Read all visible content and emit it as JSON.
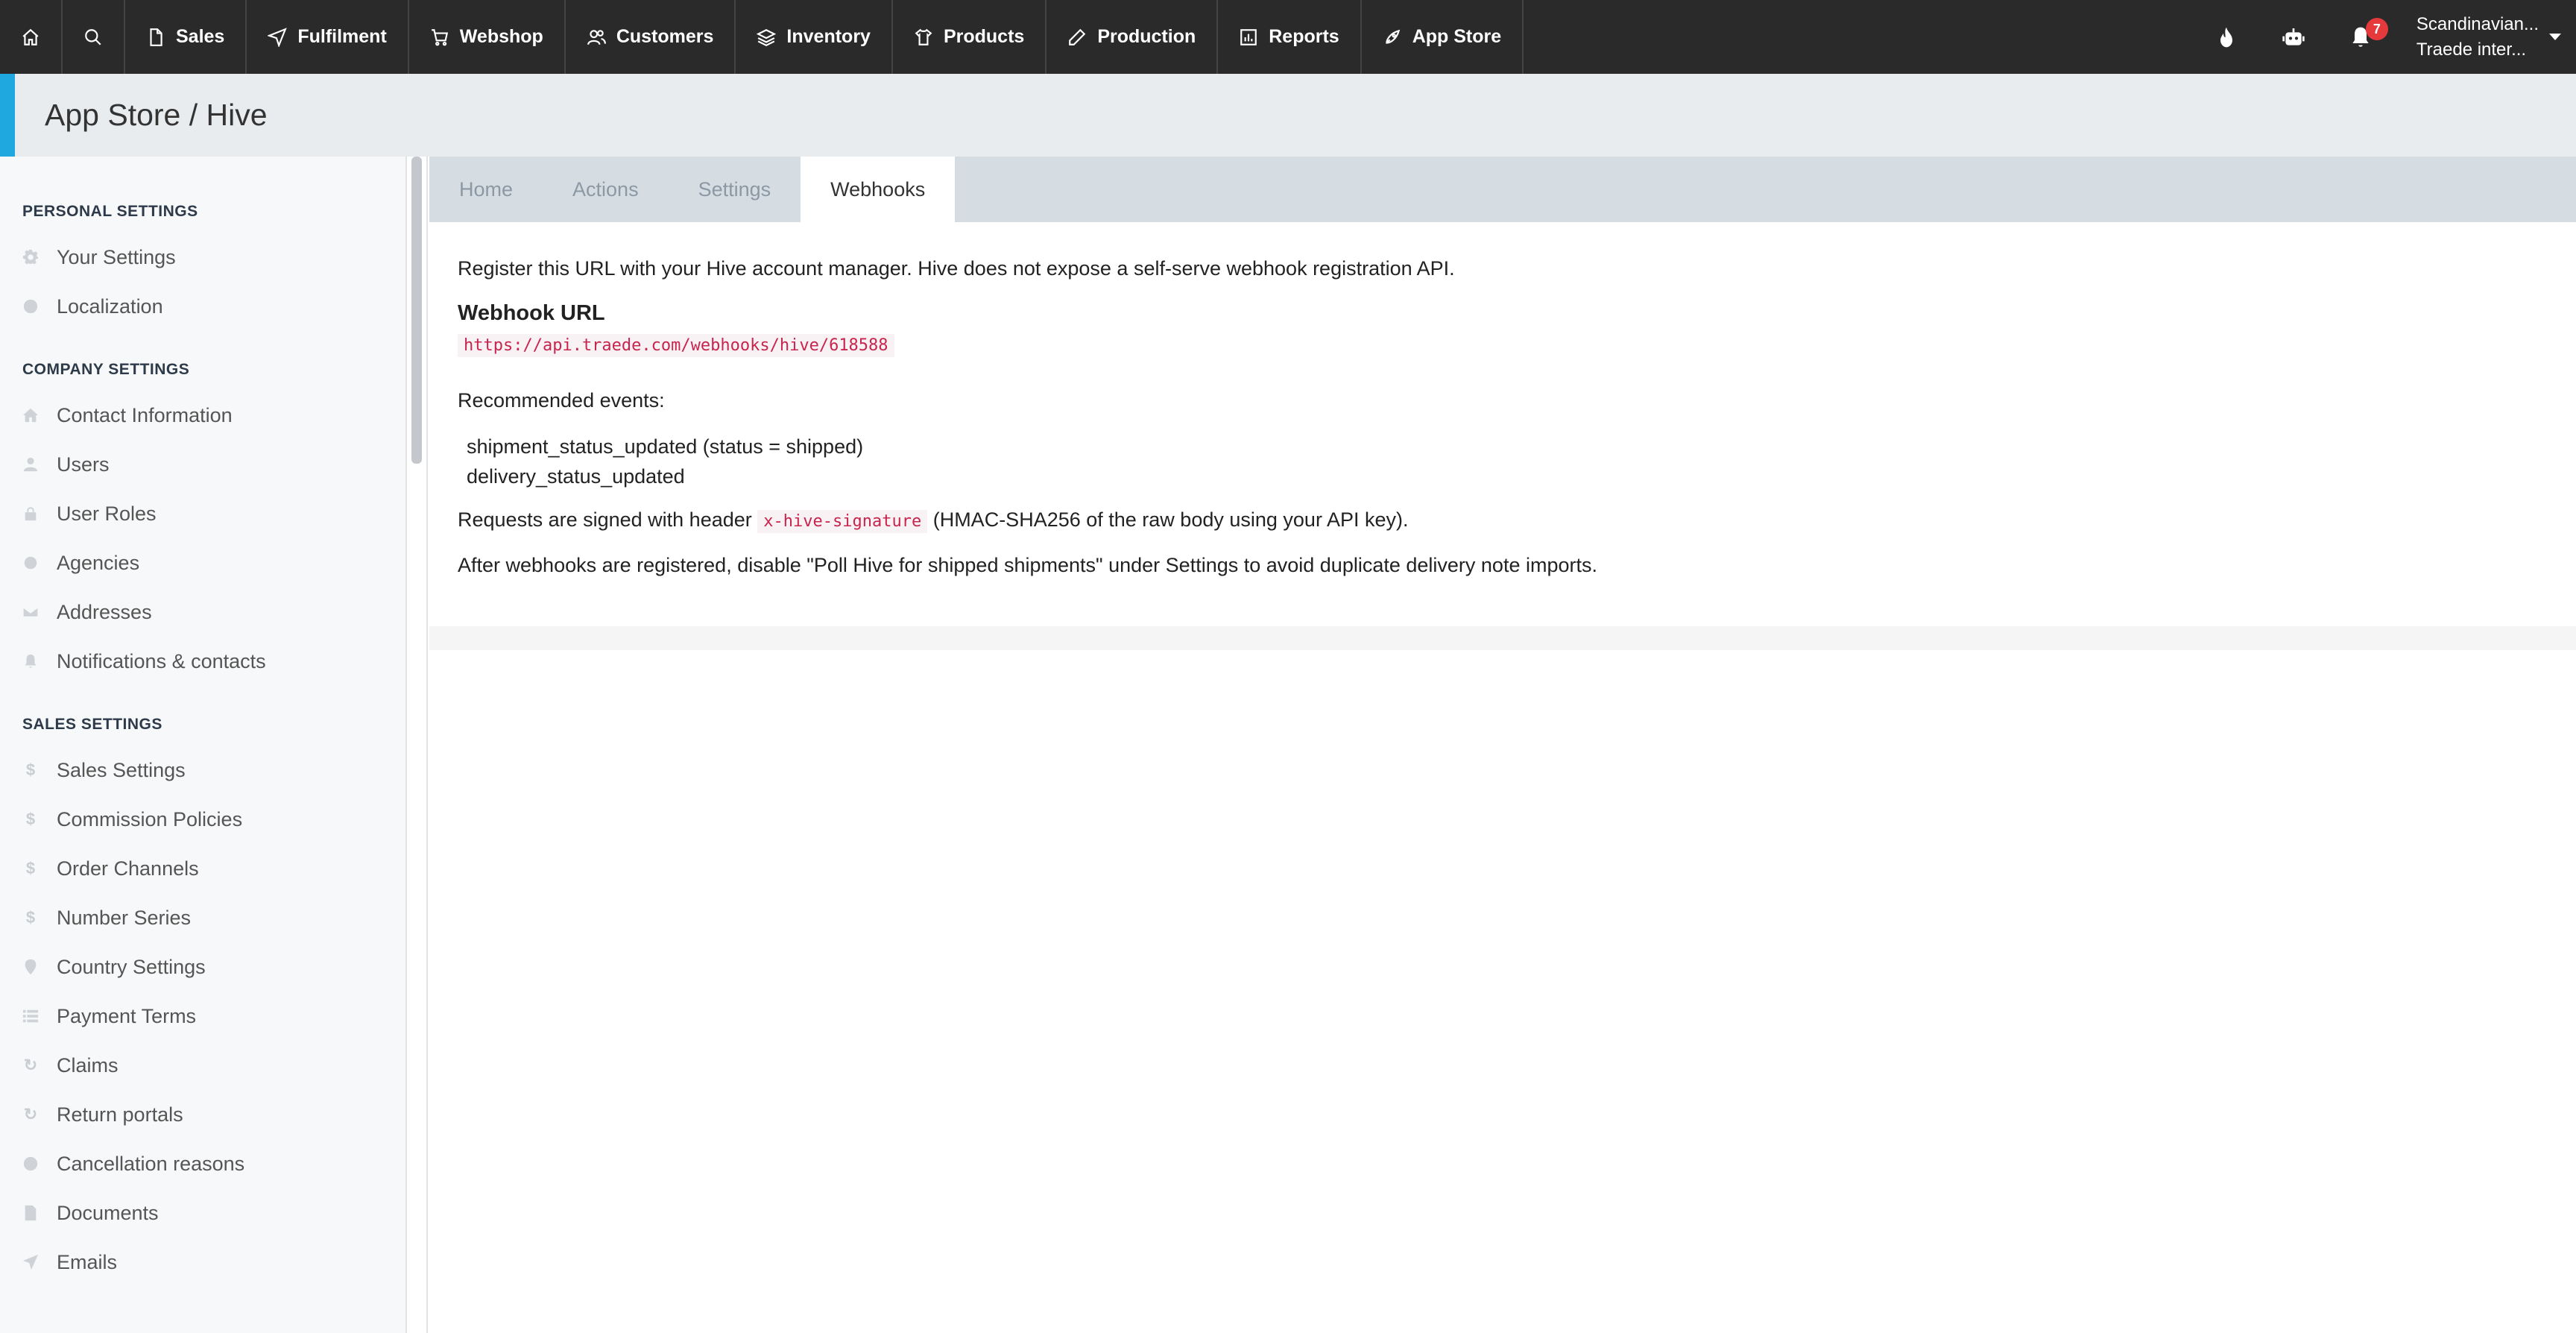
{
  "nav": {
    "items": [
      {
        "label": "Sales"
      },
      {
        "label": "Fulfilment"
      },
      {
        "label": "Webshop"
      },
      {
        "label": "Customers"
      },
      {
        "label": "Inventory"
      },
      {
        "label": "Products"
      },
      {
        "label": "Production"
      },
      {
        "label": "Reports"
      },
      {
        "label": "App Store"
      }
    ],
    "notification_count": "7",
    "account_line1": "Scandinavian...",
    "account_line2": "Traede inter..."
  },
  "page": {
    "title": "App Store / Hive"
  },
  "sidebar": {
    "personal_heading": "PERSONAL SETTINGS",
    "personal": [
      {
        "label": "Your Settings",
        "icon": "gear-icon"
      },
      {
        "label": "Localization",
        "icon": "globe-icon"
      }
    ],
    "company_heading": "COMPANY SETTINGS",
    "company": [
      {
        "label": "Contact Information",
        "icon": "home-icon"
      },
      {
        "label": "Users",
        "icon": "user-icon"
      },
      {
        "label": "User Roles",
        "icon": "lock-icon"
      },
      {
        "label": "Agencies",
        "icon": "asterisk-icon"
      },
      {
        "label": "Addresses",
        "icon": "envelope-icon"
      },
      {
        "label": "Notifications & contacts",
        "icon": "bell-icon"
      }
    ],
    "sales_heading": "SALES SETTINGS",
    "sales": [
      {
        "label": "Sales Settings",
        "icon": "dollar-icon"
      },
      {
        "label": "Commission Policies",
        "icon": "dollar-icon"
      },
      {
        "label": "Order Channels",
        "icon": "dollar-icon"
      },
      {
        "label": "Number Series",
        "icon": "dollar-icon"
      },
      {
        "label": "Country Settings",
        "icon": "map-pin-icon"
      },
      {
        "label": "Payment Terms",
        "icon": "list-icon"
      },
      {
        "label": "Claims",
        "icon": "refresh-icon"
      },
      {
        "label": "Return portals",
        "icon": "refresh-icon"
      },
      {
        "label": "Cancellation reasons",
        "icon": "question-icon"
      },
      {
        "label": "Documents",
        "icon": "file-icon"
      },
      {
        "label": "Emails",
        "icon": "send-icon"
      }
    ]
  },
  "tabs": [
    {
      "label": "Home"
    },
    {
      "label": "Actions"
    },
    {
      "label": "Settings"
    },
    {
      "label": "Webhooks",
      "active": true
    }
  ],
  "webhooks": {
    "intro": "Register this URL with your Hive account manager. Hive does not expose a self-serve webhook registration API.",
    "url_heading": "Webhook URL",
    "url": "https://api.traede.com/webhooks/hive/618588",
    "events_heading": "Recommended events:",
    "events": [
      "shipment_status_updated (status = shipped)",
      "delivery_status_updated"
    ],
    "signed_prefix": "Requests are signed with header",
    "signed_header": "x-hive-signature",
    "signed_suffix": "(HMAC-SHA256 of the raw body using your API key).",
    "after_note": "After webhooks are registered, disable \"Poll Hive for shipped shipments\" under Settings to avoid duplicate delivery note imports."
  }
}
